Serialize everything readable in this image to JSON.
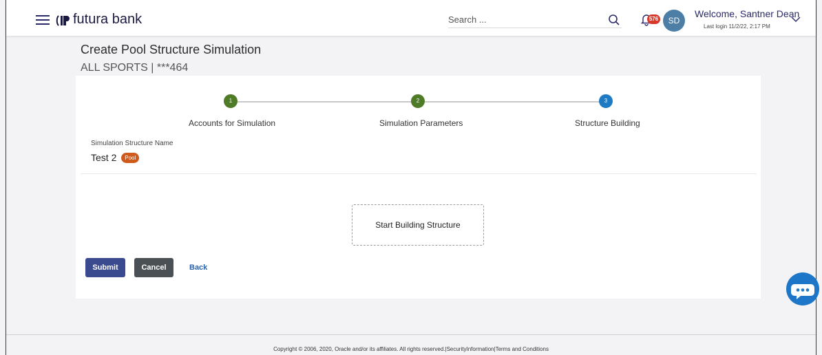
{
  "header": {
    "brand": "futura bank",
    "search_placeholder": "Search ...",
    "notification_count": "576",
    "avatar_initials": "SD",
    "welcome": "Welcome, Santner Dean",
    "last_login": "Last login 11/2/22, 2:17 PM"
  },
  "page": {
    "title": "Create Pool Structure Simulation",
    "subtitle": "ALL SPORTS | ***464"
  },
  "stepper": {
    "steps": [
      {
        "number": "1",
        "label": "Accounts for Simulation",
        "state": "completed"
      },
      {
        "number": "2",
        "label": "Simulation Parameters",
        "state": "completed"
      },
      {
        "number": "3",
        "label": "Structure Building",
        "state": "active"
      }
    ],
    "colors": {
      "completed": "#4f7a28",
      "active": "#1f7ac4"
    }
  },
  "form": {
    "name_label": "Simulation Structure Name",
    "name_value": "Test 2",
    "badge": "Pool"
  },
  "builder": {
    "start_label": "Start Building Structure"
  },
  "actions": {
    "submit": "Submit",
    "cancel": "Cancel",
    "back": "Back"
  },
  "footer": {
    "text": "Copyright © 2006, 2020, Oracle and/or its affiliates. All rights reserved.|SecurityInformation|Terms and Conditions"
  }
}
